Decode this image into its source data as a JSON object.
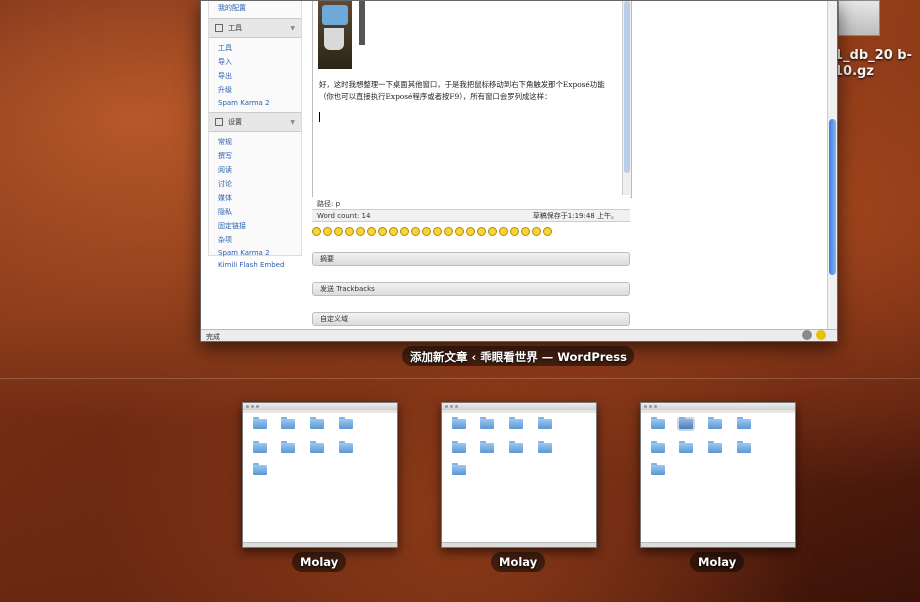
{
  "desktop": {
    "file_label": "1_db_20 b-10.gz"
  },
  "editor": {
    "sidebar": {
      "top_link": "我的配置",
      "tools_header": "工具",
      "tools_items": [
        "工具",
        "导入",
        "导出",
        "升级",
        "Spam Karma 2"
      ],
      "settings_header": "设置",
      "settings_items": [
        "常规",
        "撰写",
        "阅读",
        "讨论",
        "媒体",
        "隐私",
        "固定链接",
        "杂项",
        "Spam Karma 2",
        "Kimili Flash Embed"
      ]
    },
    "body_text": "好，这时我想整理一下桌面其他窗口，于是我把鼠标移动到右下角触发那个Exposé功能（你也可以直接执行Exposé程序或者按F9），所有窗口会罗列成这样：",
    "path_label": "路径: p",
    "word_count": "Word count: 14",
    "draft_saved": "草稿保存于1:19:48 上午。",
    "panels": [
      "摘要",
      "发送 Trackbacks",
      "自定义域"
    ],
    "status": "完成"
  },
  "expose": {
    "window_title": "添加新文章 ‹ 乖眼看世界 — WordPress",
    "minis": [
      {
        "label": "Molay"
      },
      {
        "label": "Molay"
      },
      {
        "label": "Molay"
      }
    ]
  }
}
